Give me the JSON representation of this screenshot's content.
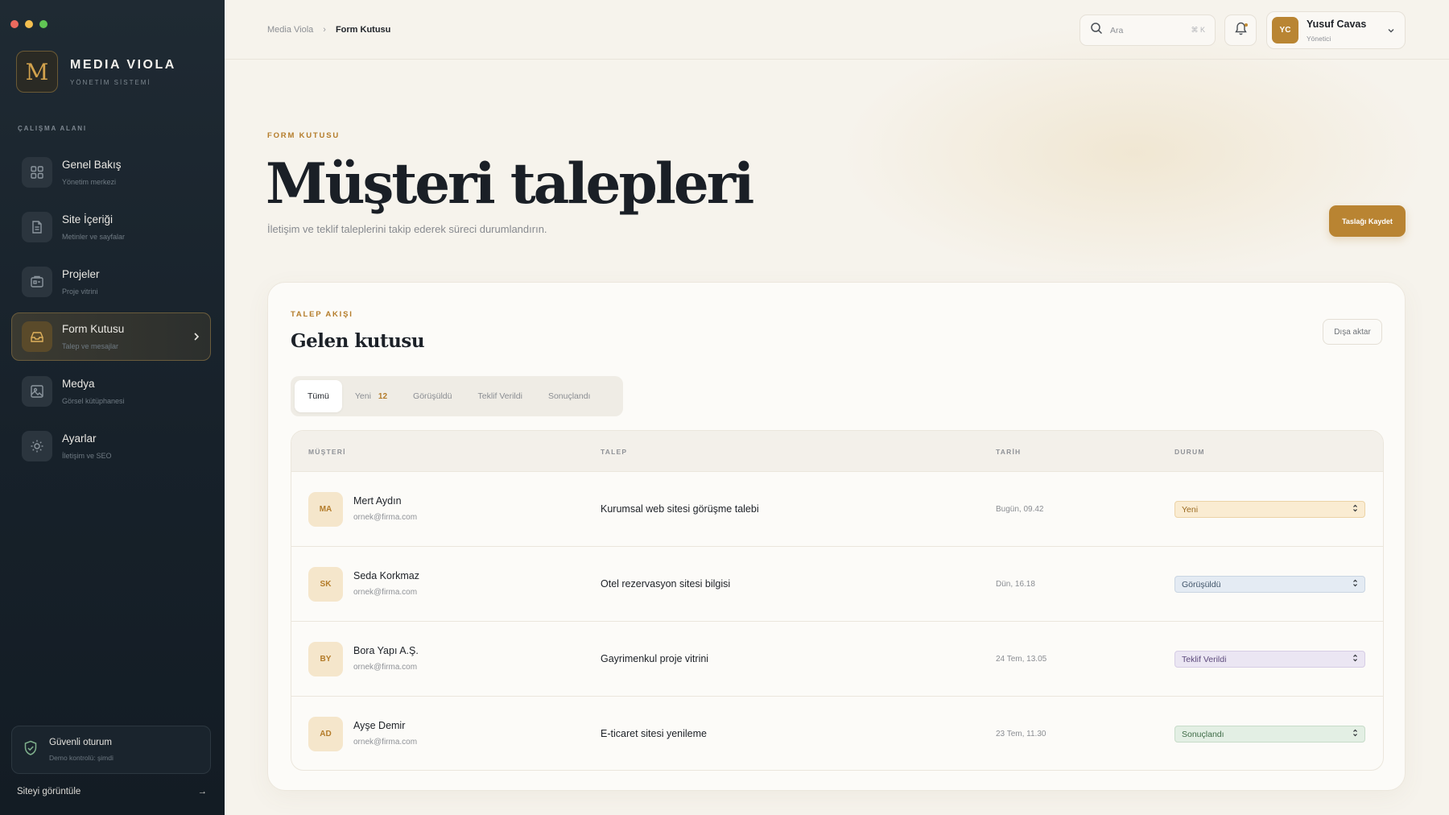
{
  "sidebar": {
    "brand": {
      "logo_letter": "M",
      "name": "MEDIA VIOLA",
      "subtitle": "YÖNETİM SİSTEMİ"
    },
    "section_label": "ÇALIŞMA ALANI",
    "items": [
      {
        "label": "Genel Bakış",
        "sub": "Yönetim merkezi",
        "icon": "grid-icon",
        "active": false
      },
      {
        "label": "Site İçeriği",
        "sub": "Metinler ve sayfalar",
        "icon": "document-icon",
        "active": false
      },
      {
        "label": "Projeler",
        "sub": "Proje vitrini",
        "icon": "projects-icon",
        "active": false
      },
      {
        "label": "Form Kutusu",
        "sub": "Talep ve mesajlar",
        "icon": "inbox-icon",
        "active": true
      },
      {
        "label": "Medya",
        "sub": "Görsel kütüphanesi",
        "icon": "image-icon",
        "active": false
      },
      {
        "label": "Ayarlar",
        "sub": "İletişim ve SEO",
        "icon": "sun-icon",
        "active": false
      }
    ],
    "secure": {
      "title": "Güvenli oturum",
      "sub": "Demo kontrolü: şimdi",
      "icon": "shield-check-icon"
    },
    "view_site": {
      "label": "Siteyi görüntüle",
      "arrow": "→"
    }
  },
  "topbar": {
    "breadcrumb": {
      "root": "Media Viola",
      "separator": "›",
      "current": "Form Kutusu"
    },
    "search": {
      "placeholder": "Ara",
      "shortcut": "⌘ K"
    },
    "user": {
      "initials": "YC",
      "name": "Yusuf Cavas",
      "role": "Yönetici"
    }
  },
  "hero": {
    "eyebrow": "FORM KUTUSU",
    "title": "Müşteri talepleri",
    "subtitle": "İletişim ve teklif taleplerini takip ederek süreci durumlandırın.",
    "save_button": "Taslağı Kaydet"
  },
  "inbox": {
    "eyebrow": "TALEP AKIŞI",
    "title": "Gelen kutusu",
    "export_button": "Dışa aktar",
    "tabs": [
      {
        "label": "Tümü",
        "active": true
      },
      {
        "label": "Yeni",
        "count": "12",
        "active": false
      },
      {
        "label": "Görüşüldü",
        "active": false
      },
      {
        "label": "Teklif Verildi",
        "active": false
      },
      {
        "label": "Sonuçlandı",
        "active": false
      }
    ],
    "columns": {
      "customer": "MÜŞTERİ",
      "request": "TALEP",
      "date": "TARİH",
      "status": "DURUM"
    },
    "rows": [
      {
        "initials": "MA",
        "name": "Mert Aydın",
        "email": "ornek@firma.com",
        "request": "Kurumsal web sitesi görüşme talebi",
        "date": "Bugün, 09.42",
        "status": "Yeni"
      },
      {
        "initials": "SK",
        "name": "Seda Korkmaz",
        "email": "ornek@firma.com",
        "request": "Otel rezervasyon sitesi bilgisi",
        "date": "Dün, 16.18",
        "status": "Görüşüldü"
      },
      {
        "initials": "BY",
        "name": "Bora Yapı A.Ş.",
        "email": "ornek@firma.com",
        "request": "Gayrimenkul proje vitrini",
        "date": "24 Tem, 13.05",
        "status": "Teklif Verildi"
      },
      {
        "initials": "AD",
        "name": "Ayşe Demir",
        "email": "ornek@firma.com",
        "request": "E-ticaret sitesi yenileme",
        "date": "23 Tem, 11.30",
        "status": "Sonuçlandı"
      }
    ]
  },
  "colors": {
    "accent": "#b98432",
    "sidebar_bg": "#1b252e",
    "page_bg": "#f6f3ec"
  }
}
